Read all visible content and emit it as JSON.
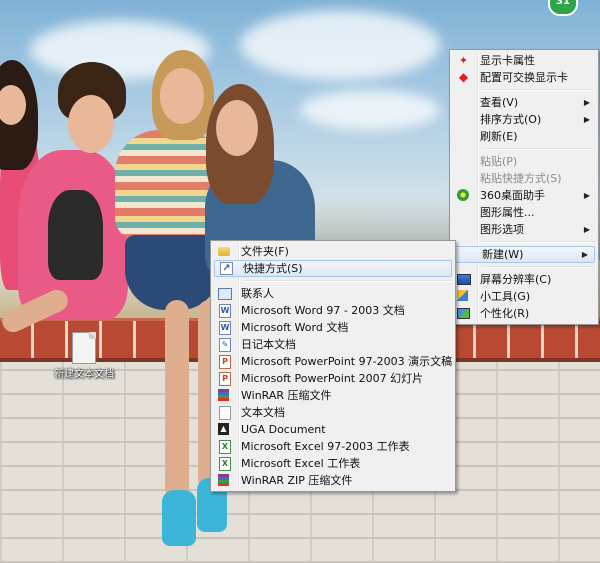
{
  "desktop": {
    "icon_label": "新建文本文档",
    "tray_badge": "31"
  },
  "context_menu": {
    "items": [
      {
        "label": "显示卡属性",
        "icon": "gpu-icon"
      },
      {
        "label": "配置可交换显示卡",
        "icon": "switchable-gpu-icon"
      },
      {
        "label": "查看(V)",
        "submenu": true
      },
      {
        "label": "排序方式(O)",
        "submenu": true
      },
      {
        "label": "刷新(E)"
      },
      {
        "label": "粘贴(P)",
        "disabled": true
      },
      {
        "label": "粘贴快捷方式(S)",
        "disabled": true
      },
      {
        "label": "360桌面助手",
        "icon": "360-icon",
        "submenu": true
      },
      {
        "label": "图形属性..."
      },
      {
        "label": "图形选项",
        "submenu": true
      },
      {
        "label": "新建(W)",
        "submenu": true,
        "highlighted": true
      },
      {
        "label": "屏幕分辨率(C)",
        "icon": "screen-icon"
      },
      {
        "label": "小工具(G)",
        "icon": "gadget-icon"
      },
      {
        "label": "个性化(R)",
        "icon": "personalize-icon"
      }
    ]
  },
  "new_submenu": {
    "items": [
      {
        "label": "文件夹(F)",
        "icon": "folder-icon"
      },
      {
        "label": "快捷方式(S)",
        "icon": "shortcut-icon",
        "highlighted": true
      },
      {
        "label": "联系人",
        "icon": "contact-icon"
      },
      {
        "label": "Microsoft Word 97 - 2003 文档",
        "icon": "word-icon"
      },
      {
        "label": "Microsoft Word 文档",
        "icon": "word-icon"
      },
      {
        "label": "日记本文档",
        "icon": "journal-icon"
      },
      {
        "label": "Microsoft PowerPoint 97-2003 演示文稿",
        "icon": "powerpoint-icon"
      },
      {
        "label": "Microsoft PowerPoint 2007 幻灯片",
        "icon": "powerpoint-icon"
      },
      {
        "label": "WinRAR 压缩文件",
        "icon": "winrar-icon"
      },
      {
        "label": "文本文档",
        "icon": "text-document-icon"
      },
      {
        "label": "UGA Document",
        "icon": "uga-icon"
      },
      {
        "label": "Microsoft Excel 97-2003 工作表",
        "icon": "excel-icon"
      },
      {
        "label": "Microsoft Excel 工作表",
        "icon": "excel-icon"
      },
      {
        "label": "WinRAR ZIP 压缩文件",
        "icon": "winrar-zip-icon"
      }
    ]
  }
}
